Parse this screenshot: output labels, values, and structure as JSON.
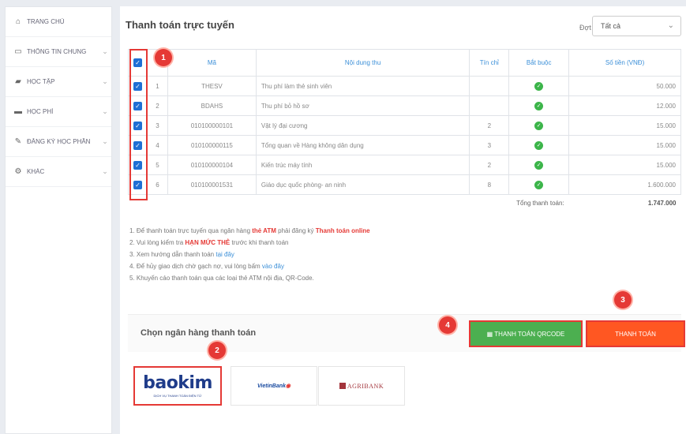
{
  "sidebar": {
    "items": [
      {
        "icon": "home-icon",
        "glyph": "⌂",
        "label": "TRANG CHỦ",
        "chevron": ""
      },
      {
        "icon": "monitor-icon",
        "glyph": "▭",
        "label": "THÔNG TIN CHUNG",
        "chevron": "⌄"
      },
      {
        "icon": "education-icon",
        "glyph": "▰",
        "label": "HỌC TẬP",
        "chevron": "⌄"
      },
      {
        "icon": "card-icon",
        "glyph": "▬",
        "label": "HỌC PHÍ",
        "chevron": "⌄"
      },
      {
        "icon": "register-icon",
        "glyph": "✎",
        "label": "ĐĂNG KÝ HỌC PHẦN",
        "chevron": "⌄"
      },
      {
        "icon": "gear-icon",
        "glyph": "⚙",
        "label": "KHÁC",
        "chevron": "⌄"
      }
    ]
  },
  "main": {
    "title": "Thanh toán trực tuyến",
    "filter_label": "Đợt",
    "filter_value": "Tất cả"
  },
  "table": {
    "headers": {
      "ma": "Mã",
      "noidung": "Nội dung thu",
      "tinchi": "Tín chỉ",
      "batbuoc": "Bắt buộc",
      "sotien": "Số tiền (VNĐ)"
    },
    "rows": [
      {
        "stt": "1",
        "ma": "THESV",
        "noidung": "Thu phí làm thẻ sinh viên",
        "tinchi": "",
        "sotien": "50.000"
      },
      {
        "stt": "2",
        "ma": "BDAHS",
        "noidung": "Thu phí bỏ hồ sơ",
        "tinchi": "",
        "sotien": "12.000"
      },
      {
        "stt": "3",
        "ma": "010100000101",
        "noidung": "Vật lý đại cương",
        "tinchi": "2",
        "sotien": "15.000"
      },
      {
        "stt": "4",
        "ma": "010100000115",
        "noidung": "Tổng quan về Hàng không dân dụng",
        "tinchi": "3",
        "sotien": "15.000"
      },
      {
        "stt": "5",
        "ma": "010100000104",
        "noidung": "Kiến trúc máy tính",
        "tinchi": "2",
        "sotien": "15.000"
      },
      {
        "stt": "6",
        "ma": "010100001531",
        "noidung": "Giáo dục quốc phòng- an ninh",
        "tinchi": "8",
        "sotien": "1.600.000"
      }
    ],
    "total_label": "Tổng thanh toán:",
    "total_value": "1.747.000"
  },
  "notes": {
    "n1_a": "1. Để thanh toán trực tuyến qua ngân hàng ",
    "n1_b": "thẻ ATM",
    "n1_c": " phải đăng ký ",
    "n1_d": "Thanh toán online",
    "n2_a": "2. Vui lòng kiểm tra ",
    "n2_b": "HẠN MỨC THẺ",
    "n2_c": " trước khi thanh toán",
    "n3_a": "3. Xem hướng dẫn thanh toán ",
    "n3_b": "tại đây",
    "n4_a": "4. Để hủy giao dịch chờ gạch nợ, vui lòng bấm ",
    "n4_b": "vào đây",
    "n5": "5. Khuyến cáo thanh toán qua các loại thẻ ATM nội địa, QR-Code."
  },
  "bank": {
    "title": "Chọn ngân hàng thanh toán",
    "qr_button": "▦ THANH TOÁN QRCODE",
    "pay_button": "THANH TOÁN",
    "baokim_logo": "baokim",
    "baokim_sub": "DỊCH VỤ THANH TOÁN ĐIỆN TỬ",
    "vietin_logo": "VietinBank",
    "agri_logo": "AGRIBANK"
  },
  "annotations": [
    "1",
    "2",
    "3",
    "4"
  ],
  "colors": {
    "accent": "#3b8fd8",
    "annotation": "#e53935",
    "qr_button": "#4caf50",
    "pay_button": "#ff5722"
  }
}
